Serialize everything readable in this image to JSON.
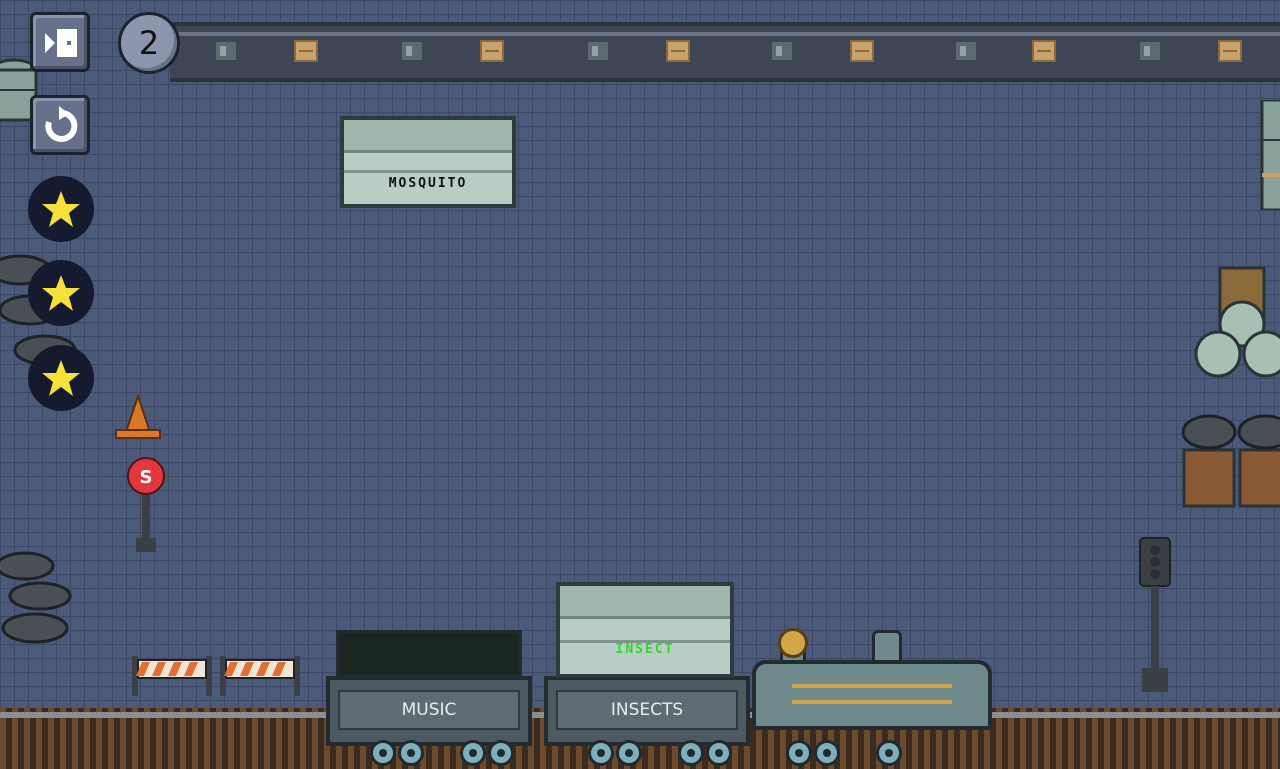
{
  "hud": {
    "exit_icon": "exit-door-icon",
    "restart_icon": "restart-icon",
    "level_number": "2",
    "stars": [
      "star-icon",
      "star-icon",
      "star-icon"
    ],
    "star_color": "#f4e13a"
  },
  "target_crate": {
    "label": "MOSQUITO"
  },
  "train": {
    "wagons": [
      {
        "label": "MUSIC",
        "cargo": ""
      },
      {
        "label": "INSECTS",
        "cargo": "INSECT"
      }
    ],
    "cargo_text_color": "#2bd92b"
  }
}
